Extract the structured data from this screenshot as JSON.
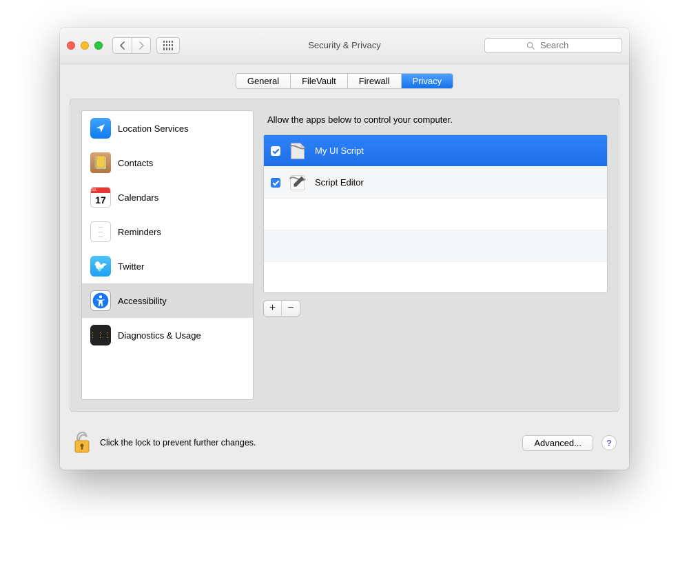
{
  "window": {
    "title": "Security & Privacy"
  },
  "toolbar": {
    "search_placeholder": "Search"
  },
  "tabs": {
    "items": [
      {
        "label": "General",
        "active": false
      },
      {
        "label": "FileVault",
        "active": false
      },
      {
        "label": "Firewall",
        "active": false
      },
      {
        "label": "Privacy",
        "active": true
      }
    ]
  },
  "sidebar": {
    "items": [
      {
        "label": "Location Services",
        "icon": "location-icon"
      },
      {
        "label": "Contacts",
        "icon": "contacts-icon"
      },
      {
        "label": "Calendars",
        "icon": "calendar-icon"
      },
      {
        "label": "Reminders",
        "icon": "reminders-icon"
      },
      {
        "label": "Twitter",
        "icon": "twitter-icon"
      },
      {
        "label": "Accessibility",
        "icon": "accessibility-icon",
        "selected": true
      },
      {
        "label": "Diagnostics & Usage",
        "icon": "diagnostics-icon"
      }
    ]
  },
  "calendar_icon_day": "17",
  "pane": {
    "header": "Allow the apps below to control your computer.",
    "apps": [
      {
        "label": "My UI Script",
        "checked": true,
        "selected": true
      },
      {
        "label": "Script Editor",
        "checked": true,
        "selected": false
      }
    ]
  },
  "footer": {
    "lock_text": "Click the lock to prevent further changes.",
    "advanced_label": "Advanced...",
    "help_label": "?"
  },
  "colors": {
    "accent": "#1f6fe8",
    "selection": "#2f82f7"
  }
}
